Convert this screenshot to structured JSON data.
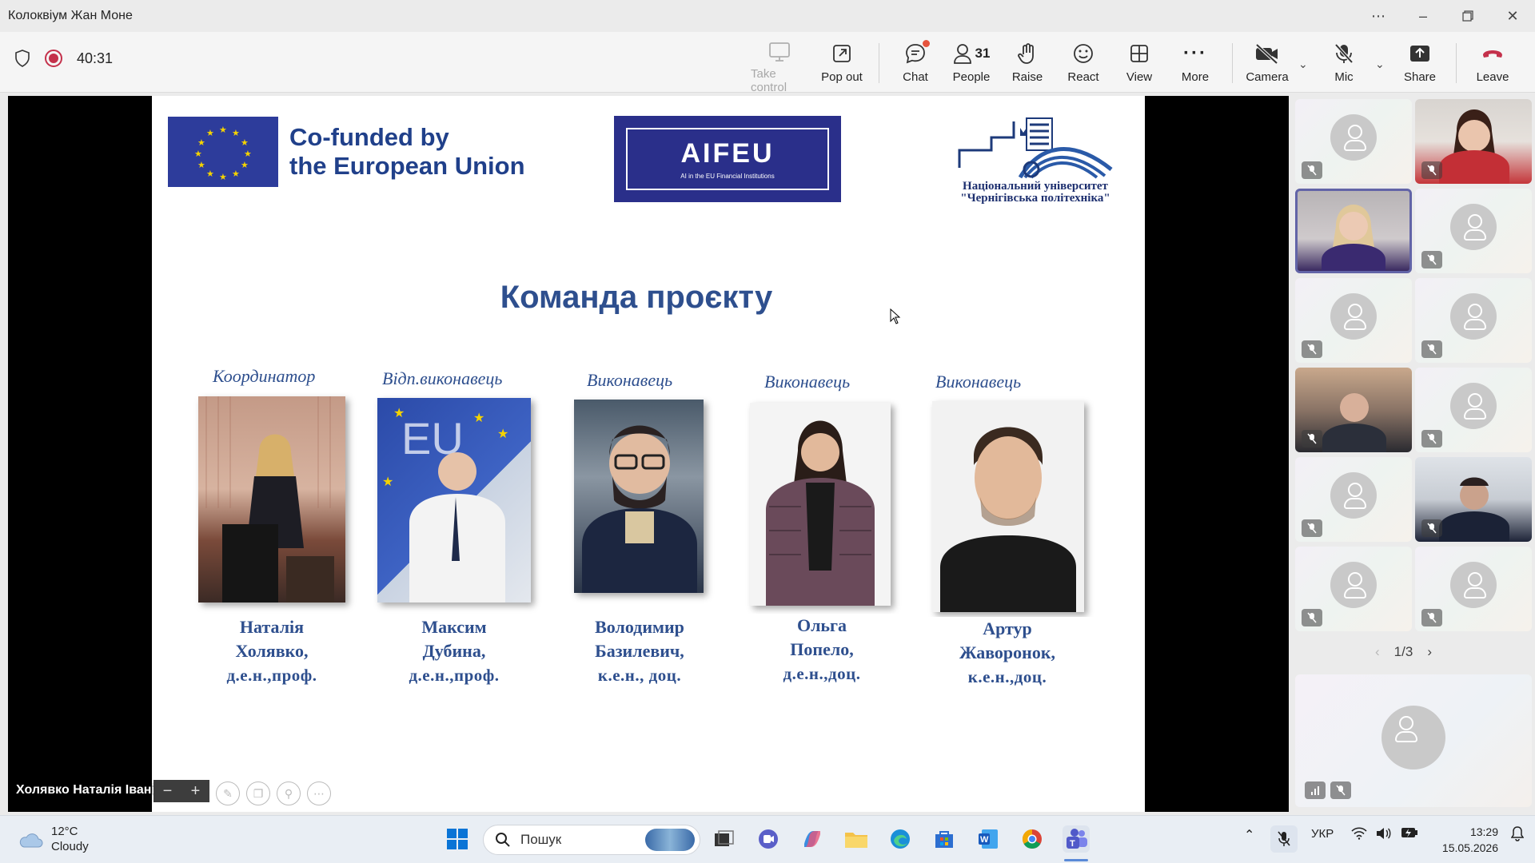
{
  "window": {
    "title": "Колоквіум Жан Моне"
  },
  "meeting": {
    "timer": "40:31"
  },
  "toolbar": {
    "take_control": "Take control",
    "pop_out": "Pop out",
    "chat": "Chat",
    "people": "People",
    "people_count": "31",
    "raise": "Raise",
    "react": "React",
    "view": "View",
    "more": "More",
    "camera": "Camera",
    "mic": "Mic",
    "share": "Share",
    "leave": "Leave"
  },
  "slide": {
    "eu_line1": "Co-funded by",
    "eu_line2": "the European Union",
    "aifeu_title": "AIFEU",
    "aifeu_sub": "AI in the EU Financial Institutions",
    "univ_line1": "Національний університет",
    "univ_line2": "\"Чернігівська політехніка\"",
    "title": "Команда проєкту",
    "members": [
      {
        "role": "Координатор",
        "name1": "Наталія",
        "name2": "Холявко,",
        "degree": "д.е.н.,проф."
      },
      {
        "role": "Відп.виконавець",
        "name1": "Максим",
        "name2": "Дубина,",
        "degree": "д.е.н.,проф."
      },
      {
        "role": "Виконавець",
        "name1": "Володимир",
        "name2": "Базилевич,",
        "degree": "к.е.н., доц."
      },
      {
        "role": "Виконавець",
        "name1": "Ольга",
        "name2": "Попело,",
        "degree": "д.е.н.,доц."
      },
      {
        "role": "Виконавець",
        "name1": "Артур",
        "name2": "Жаворонок,",
        "degree": "к.е.н.,доц."
      }
    ]
  },
  "presenter": {
    "name": "Холявко Наталія Іванівна"
  },
  "participants": {
    "page": "1/3"
  },
  "taskbar": {
    "temp": "12°C",
    "condition": "Cloudy",
    "search_placeholder": "Пошук",
    "lang": "УКР",
    "time": "13:29",
    "date": "15.05.2026"
  },
  "colors": {
    "accent": "#6264a7",
    "leave": "#c4314b",
    "slide_blue": "#2e4f8e",
    "eu_blue": "#2d3c9b",
    "eu_star": "#f5d300"
  }
}
